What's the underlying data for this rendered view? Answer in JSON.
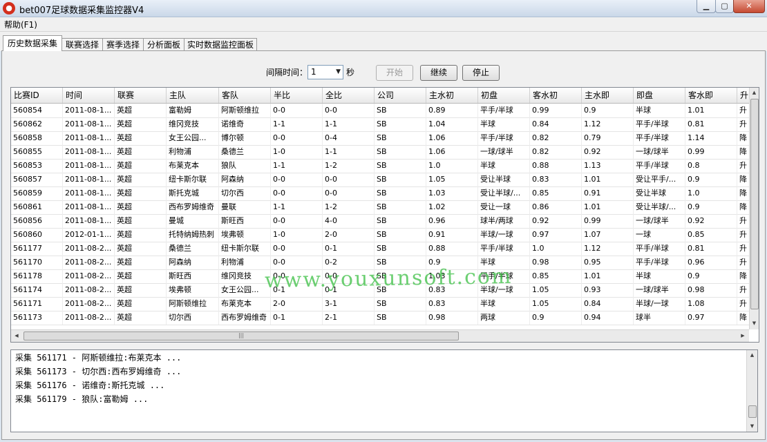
{
  "window": {
    "title": "bet007足球数据采集监控器V4",
    "icon": "ball-app-icon"
  },
  "menu": {
    "help": "帮助(F1)"
  },
  "tabs": [
    "历史数据采集",
    "联赛选择",
    "赛季选择",
    "分析面板",
    "实时数据监控面板"
  ],
  "toolbar": {
    "interval_label": "间隔时间：",
    "interval_value": "1",
    "unit": "秒",
    "start": "开始",
    "resume": "继续",
    "stop": "停止"
  },
  "columns": [
    "比赛ID",
    "时间",
    "联赛",
    "主队",
    "客队",
    "半比",
    "全比",
    "公司",
    "主水初",
    "初盘",
    "客水初",
    "主水即",
    "即盘",
    "客水即",
    "升"
  ],
  "rows": [
    [
      "560854",
      "2011-08-1...",
      "英超",
      "富勒姆",
      "阿斯顿维拉",
      "0-0",
      "0-0",
      "SB",
      "0.89",
      "平手/半球",
      "0.99",
      "0.9",
      "半球",
      "1.01",
      "升"
    ],
    [
      "560862",
      "2011-08-1...",
      "英超",
      "维冈竞技",
      "诺维奇",
      "1-1",
      "1-1",
      "SB",
      "1.04",
      "半球",
      "0.84",
      "1.12",
      "平手/半球",
      "0.81",
      "升"
    ],
    [
      "560858",
      "2011-08-1...",
      "英超",
      "女王公园...",
      "博尔顿",
      "0-0",
      "0-4",
      "SB",
      "1.06",
      "平手/半球",
      "0.82",
      "0.79",
      "平手/半球",
      "1.14",
      "降"
    ],
    [
      "560855",
      "2011-08-1...",
      "英超",
      "利物浦",
      "桑德兰",
      "1-0",
      "1-1",
      "SB",
      "1.06",
      "一球/球半",
      "0.82",
      "0.92",
      "一球/球半",
      "0.99",
      "降"
    ],
    [
      "560853",
      "2011-08-1...",
      "英超",
      "布莱克本",
      "狼队",
      "1-1",
      "1-2",
      "SB",
      "1.0",
      "半球",
      "0.88",
      "1.13",
      "平手/半球",
      "0.8",
      "升"
    ],
    [
      "560857",
      "2011-08-1...",
      "英超",
      "纽卡斯尔联",
      "阿森纳",
      "0-0",
      "0-0",
      "SB",
      "1.05",
      "受让半球",
      "0.83",
      "1.01",
      "受让平手/...",
      "0.9",
      "降"
    ],
    [
      "560859",
      "2011-08-1...",
      "英超",
      "斯托克城",
      "切尔西",
      "0-0",
      "0-0",
      "SB",
      "1.03",
      "受让半球/...",
      "0.85",
      "0.91",
      "受让半球",
      "1.0",
      "降"
    ],
    [
      "560861",
      "2011-08-1...",
      "英超",
      "西布罗姆维奇",
      "曼联",
      "1-1",
      "1-2",
      "SB",
      "1.02",
      "受让一球",
      "0.86",
      "1.01",
      "受让半球/...",
      "0.9",
      "降"
    ],
    [
      "560856",
      "2011-08-1...",
      "英超",
      "曼城",
      "斯旺西",
      "0-0",
      "4-0",
      "SB",
      "0.96",
      "球半/两球",
      "0.92",
      "0.99",
      "一球/球半",
      "0.92",
      "升"
    ],
    [
      "560860",
      "2012-01-1...",
      "英超",
      "托特纳姆热刺",
      "埃弗顿",
      "1-0",
      "2-0",
      "SB",
      "0.91",
      "半球/一球",
      "0.97",
      "1.07",
      "一球",
      "0.85",
      "升"
    ],
    [
      "561177",
      "2011-08-2...",
      "英超",
      "桑德兰",
      "纽卡斯尔联",
      "0-0",
      "0-1",
      "SB",
      "0.88",
      "平手/半球",
      "1.0",
      "1.12",
      "平手/半球",
      "0.81",
      "升"
    ],
    [
      "561170",
      "2011-08-2...",
      "英超",
      "阿森纳",
      "利物浦",
      "0-0",
      "0-2",
      "SB",
      "0.9",
      "半球",
      "0.98",
      "0.95",
      "平手/半球",
      "0.96",
      "升"
    ],
    [
      "561178",
      "2011-08-2...",
      "英超",
      "斯旺西",
      "维冈竞技",
      "0-0",
      "0-0",
      "SB",
      "1.03",
      "平手/半球",
      "0.85",
      "1.01",
      "半球",
      "0.9",
      "降"
    ],
    [
      "561174",
      "2011-08-2...",
      "英超",
      "埃弗顿",
      "女王公园...",
      "0-1",
      "0-1",
      "SB",
      "0.83",
      "半球/一球",
      "1.05",
      "0.93",
      "一球/球半",
      "0.98",
      "升"
    ],
    [
      "561171",
      "2011-08-2...",
      "英超",
      "阿斯顿维拉",
      "布莱克本",
      "2-0",
      "3-1",
      "SB",
      "0.83",
      "半球",
      "1.05",
      "0.84",
      "半球/一球",
      "1.08",
      "升"
    ],
    [
      "561173",
      "2011-08-2...",
      "英超",
      "切尔西",
      "西布罗姆维奇",
      "0-1",
      "2-1",
      "SB",
      "0.98",
      "两球",
      "0.9",
      "0.94",
      "球半",
      "0.97",
      "降"
    ]
  ],
  "watermark": "www.youxunsoft.com",
  "log": [
    "采集 561171 - 阿斯顿维拉:布莱克本 ...",
    "采集 561173 - 切尔西:西布罗姆维奇 ...",
    "采集 561176 - 诺维奇:斯托克城 ...",
    "采集 561179 - 狼队:富勒姆 ..."
  ]
}
